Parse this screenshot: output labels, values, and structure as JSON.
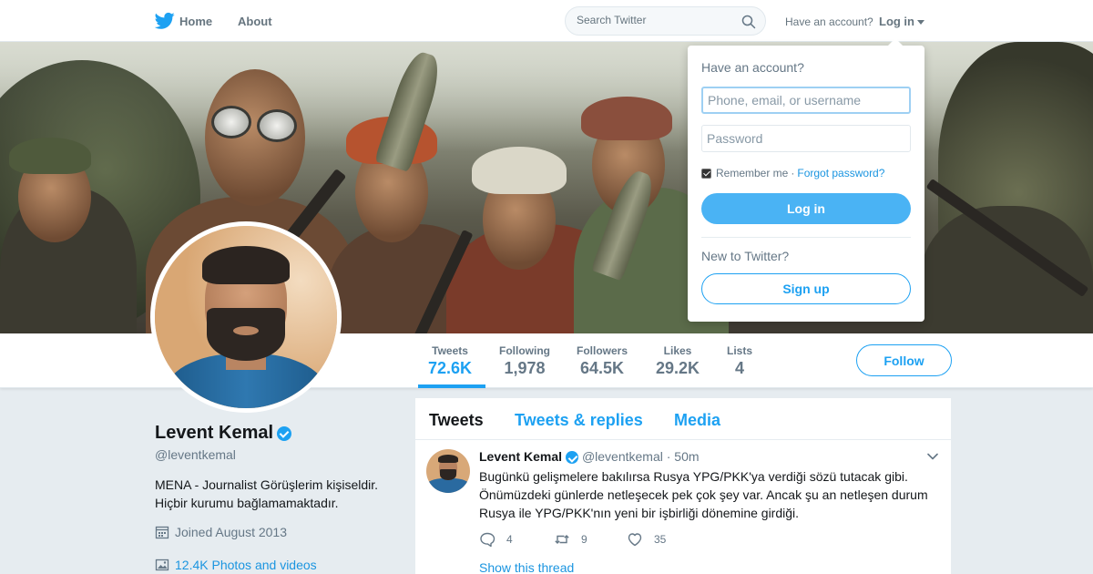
{
  "nav": {
    "home_label": "Home",
    "about_label": "About",
    "search_placeholder": "Search Twitter",
    "have_account": "Have an account?",
    "login_label": "Log in"
  },
  "profile": {
    "name": "Levent Kemal",
    "handle": "@leventkemal",
    "bio": "MENA - Journalist Görüşlerim kişiseldir. Hiçbir kurumu bağlamamaktadır.",
    "joined": "Joined August 2013",
    "photos_videos": "12.4K Photos and videos",
    "verified": true
  },
  "stats": [
    {
      "label": "Tweets",
      "value": "72.6K"
    },
    {
      "label": "Following",
      "value": "1,978"
    },
    {
      "label": "Followers",
      "value": "64.5K"
    },
    {
      "label": "Likes",
      "value": "29.2K"
    },
    {
      "label": "Lists",
      "value": "4"
    }
  ],
  "follow_label": "Follow",
  "timeline": {
    "tabs": [
      "Tweets",
      "Tweets & replies",
      "Media"
    ],
    "tweet": {
      "name": "Levent Kemal",
      "handle": "@leventkemal",
      "time": "· 50m",
      "text": "Bugünkü gelişmelere bakılırsa Rusya YPG/PKK'ya verdiği sözü tutacak gibi. Önümüzdeki günlerde netleşecek pek çok şey var. Ancak şu an netleşen durum Rusya ile YPG/PKK'nın yeni bir işbirliği dönemine girdiği.",
      "replies": "4",
      "retweets": "9",
      "likes": "35",
      "show_thread": "Show this thread"
    }
  },
  "login_dropdown": {
    "title": "Have an account?",
    "username_placeholder": "Phone, email, or username",
    "password_placeholder": "Password",
    "remember_me": "Remember me",
    "forgot_password": "Forgot password?",
    "login_button": "Log in",
    "new_to_twitter": "New to Twitter?",
    "signup_button": "Sign up"
  },
  "colors": {
    "accent": "#1da1f2",
    "link": "#1b95e0",
    "text_secondary": "#657786",
    "background": "#e6ecf0"
  }
}
